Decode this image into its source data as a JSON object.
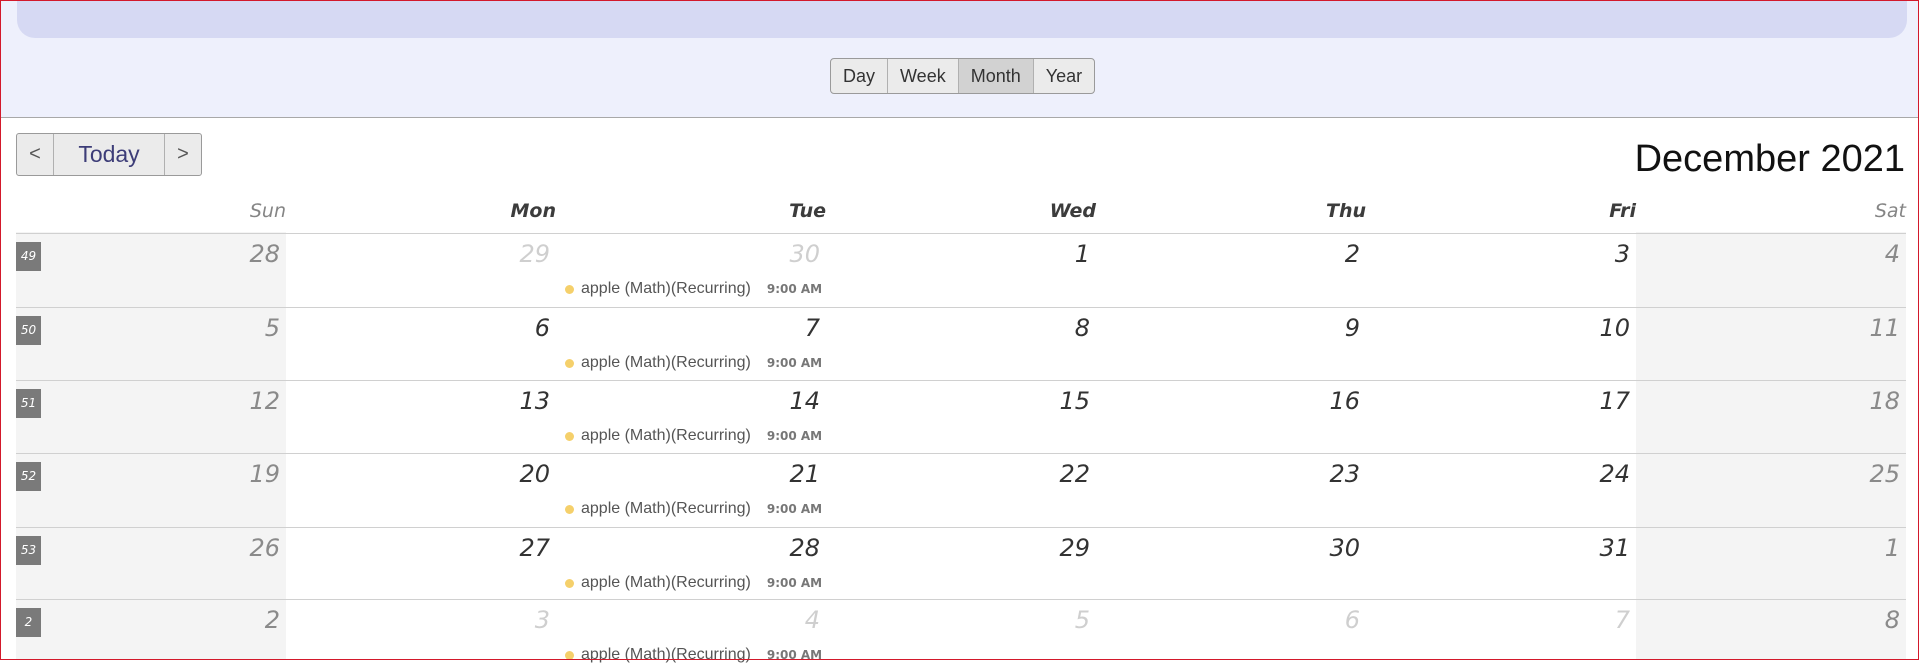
{
  "views": [
    "Day",
    "Week",
    "Month",
    "Year"
  ],
  "active_view": "Month",
  "nav": {
    "prev": "<",
    "today": "Today",
    "next": ">"
  },
  "month_title": "December 2021",
  "days_of_week": [
    "Sun",
    "Mon",
    "Tue",
    "Wed",
    "Thu",
    "Fri",
    "Sat"
  ],
  "event": {
    "title": "apple (Math)(Recurring)",
    "time": "9:00 AM",
    "color": "#f5d06b"
  },
  "weeks": [
    {
      "num": "49",
      "days": [
        {
          "d": "28"
        },
        {
          "d": "29",
          "other": true
        },
        {
          "d": "30",
          "other": true
        },
        {
          "d": "1"
        },
        {
          "d": "2"
        },
        {
          "d": "3"
        },
        {
          "d": "4"
        }
      ]
    },
    {
      "num": "50",
      "days": [
        {
          "d": "5"
        },
        {
          "d": "6"
        },
        {
          "d": "7"
        },
        {
          "d": "8"
        },
        {
          "d": "9"
        },
        {
          "d": "10"
        },
        {
          "d": "11"
        }
      ]
    },
    {
      "num": "51",
      "days": [
        {
          "d": "12"
        },
        {
          "d": "13"
        },
        {
          "d": "14"
        },
        {
          "d": "15"
        },
        {
          "d": "16"
        },
        {
          "d": "17"
        },
        {
          "d": "18"
        }
      ]
    },
    {
      "num": "52",
      "days": [
        {
          "d": "19"
        },
        {
          "d": "20"
        },
        {
          "d": "21"
        },
        {
          "d": "22"
        },
        {
          "d": "23"
        },
        {
          "d": "24"
        },
        {
          "d": "25"
        }
      ]
    },
    {
      "num": "53",
      "days": [
        {
          "d": "26"
        },
        {
          "d": "27"
        },
        {
          "d": "28"
        },
        {
          "d": "29"
        },
        {
          "d": "30"
        },
        {
          "d": "31"
        },
        {
          "d": "1"
        }
      ]
    },
    {
      "num": "2",
      "days": [
        {
          "d": "2"
        },
        {
          "d": "3",
          "other": true
        },
        {
          "d": "4",
          "other": true
        },
        {
          "d": "5",
          "other": true
        },
        {
          "d": "6",
          "other": true
        },
        {
          "d": "7",
          "other": true
        },
        {
          "d": "8"
        }
      ]
    }
  ]
}
